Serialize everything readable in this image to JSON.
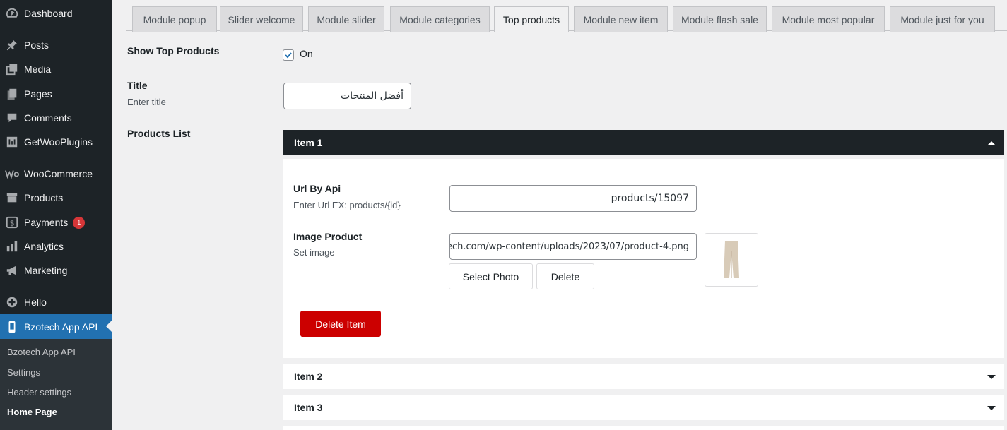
{
  "sidebar": {
    "items": [
      {
        "label": "Dashboard",
        "icon": "dashboard-icon"
      },
      {
        "label": "Posts",
        "icon": "pin-icon"
      },
      {
        "label": "Media",
        "icon": "media-icon"
      },
      {
        "label": "Pages",
        "icon": "pages-icon"
      },
      {
        "label": "Comments",
        "icon": "comments-icon"
      },
      {
        "label": "GetWooPlugins",
        "icon": "plugins-icon"
      },
      {
        "label": "WooCommerce",
        "icon": "woocommerce-icon"
      },
      {
        "label": "Products",
        "icon": "archive-icon"
      },
      {
        "label": "Payments",
        "icon": "payments-icon",
        "badge": "1"
      },
      {
        "label": "Analytics",
        "icon": "bar-chart-icon"
      },
      {
        "label": "Marketing",
        "icon": "megaphone-icon"
      },
      {
        "label": "Hello",
        "icon": "plus-circle-icon"
      },
      {
        "label": "Bzotech App API",
        "icon": "phone-icon"
      }
    ],
    "submenu": [
      {
        "label": "Bzotech App API"
      },
      {
        "label": "Settings"
      },
      {
        "label": "Header settings"
      },
      {
        "label": "Home Page"
      }
    ]
  },
  "tabs": [
    {
      "label": "Module popup"
    },
    {
      "label": "Slider welcome"
    },
    {
      "label": "Module slider"
    },
    {
      "label": "Module categories"
    },
    {
      "label": "Top products"
    },
    {
      "label": "Module new item"
    },
    {
      "label": "Module flash sale"
    },
    {
      "label": "Module most popular"
    },
    {
      "label": "Module just for you"
    }
  ],
  "active_tab": "Top products",
  "form": {
    "show_label": "Show Top Products",
    "show_checked": true,
    "show_on_text": "On",
    "title_label": "Title",
    "title_desc": "Enter title",
    "title_value": "أفضل المنتجات",
    "products_label": "Products List"
  },
  "items": [
    {
      "header": "Item 1",
      "expanded": true,
      "url_label": "Url By Api",
      "url_desc": "Enter Url EX: products/{id}",
      "url_value": "products/15097",
      "image_label": "Image Product",
      "image_desc": "Set image",
      "image_value": "ech.com/wp-content/uploads/2023/07/product-4.png",
      "select_photo": "Select Photo",
      "delete": "Delete",
      "delete_item": "Delete Item"
    },
    {
      "header": "Item 2",
      "expanded": false
    },
    {
      "header": "Item 3",
      "expanded": false
    }
  ],
  "colors": {
    "sidebar_bg": "#1d2327",
    "active_menu": "#2271b1",
    "danger": "#cc0000",
    "badge": "#d63638",
    "checkbox": "#2271b1"
  }
}
